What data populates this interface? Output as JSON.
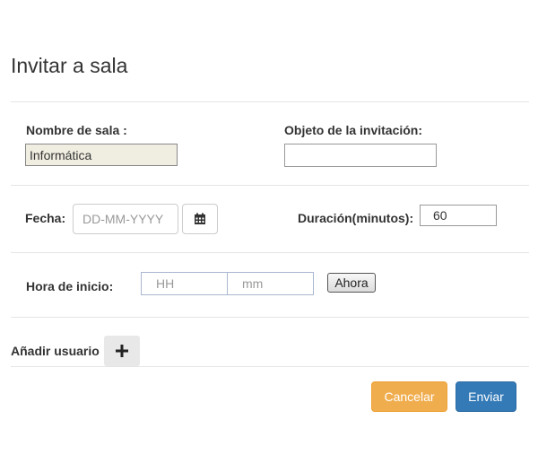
{
  "dialog": {
    "title": "Invitar a sala"
  },
  "form": {
    "room_name_label": "Nombre de sala :",
    "room_name_value": "Informática",
    "invitation_subject_label": "Objeto de la invitación:",
    "invitation_subject_value": "",
    "date_label": "Fecha:",
    "date_placeholder": "DD-MM-YYYY",
    "duration_label": "Duración(minutos):",
    "duration_value": "60",
    "start_time_label": "Hora de inicio:",
    "hour_placeholder": "HH",
    "minute_placeholder": "mm",
    "now_button": "Ahora",
    "add_user_label": "Añadir usuario"
  },
  "footer": {
    "cancel_label": "Cancelar",
    "send_label": "Enviar"
  },
  "colors": {
    "cancel": "#f0ad4e",
    "send": "#337ab7",
    "readonly_field": "#f0eee1"
  },
  "icons": {
    "calendar": "calendar-icon",
    "add": "plus-icon"
  }
}
